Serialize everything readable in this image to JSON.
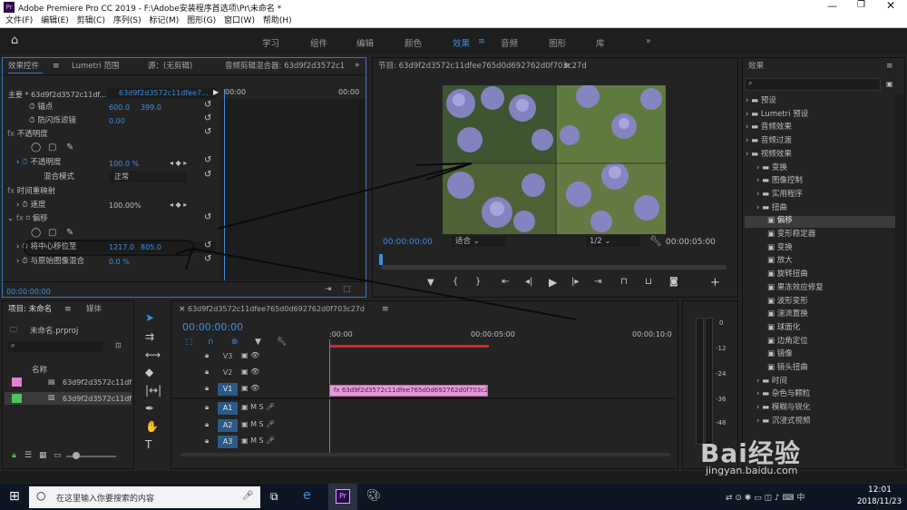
{
  "window": {
    "title": "Adobe Premiere Pro CC 2019 - F:\\Adobe安装程序首选项\\Pr\\未命名 *"
  },
  "menu": [
    "文件(F)",
    "编辑(E)",
    "剪辑(C)",
    "序列(S)",
    "标记(M)",
    "图形(G)",
    "窗口(W)",
    "帮助(H)"
  ],
  "workspaces": [
    "学习",
    "组件",
    "编辑",
    "颜色",
    "效果",
    "音频",
    "图形",
    "库"
  ],
  "effect_controls": {
    "tabs": [
      "效果控件",
      "Lumetri 范围",
      "源：(无剪辑)",
      "音频剪辑混合器: 63d9f2d3572c1"
    ],
    "master": "主要 * 63d9f2d3572c11df...",
    "clip": "63d9f2d3572c11dfee7...",
    "ruler_start": "00:00",
    "ruler_end": "00:00",
    "rows": [
      {
        "label": "锚点",
        "v1": "600.0",
        "v2": "399.0"
      },
      {
        "label": "防闪烁滤镜",
        "v1": "0.00"
      },
      {
        "label": "不透明度"
      },
      {
        "label": "不透明度",
        "v1": "100.0 %"
      },
      {
        "label": "混合模式",
        "v1": "正常"
      },
      {
        "label": "时间重映射"
      },
      {
        "label": "速度",
        "v1": "100.00%"
      },
      {
        "label": "偏移"
      },
      {
        "label": "将中心移位至",
        "v1": "1217.0",
        "v2": "805.0"
      },
      {
        "label": "与原始图像混合",
        "v1": "0.0 %"
      }
    ],
    "timecode": "00:00:00:00"
  },
  "program": {
    "title": "节目: 63d9f2d3572c11dfee765d0d692762d0f703c27d",
    "timecode": "00:00:00:00",
    "fit": "适合",
    "resolution": "1/2",
    "duration": "00:00:05:00"
  },
  "effects_panel": {
    "title": "效果",
    "items": [
      {
        "label": "预设",
        "level": 0
      },
      {
        "label": "Lumetri 预设",
        "level": 0
      },
      {
        "label": "音频效果",
        "level": 0
      },
      {
        "label": "音频过渡",
        "level": 0
      },
      {
        "label": "视频效果",
        "level": 0
      },
      {
        "label": "变换",
        "level": 1
      },
      {
        "label": "图像控制",
        "level": 1
      },
      {
        "label": "实用程序",
        "level": 1
      },
      {
        "label": "扭曲",
        "level": 1
      },
      {
        "label": "偏移",
        "level": 2,
        "sel": true
      },
      {
        "label": "变形稳定器",
        "level": 2
      },
      {
        "label": "变换",
        "level": 2
      },
      {
        "label": "放大",
        "level": 2
      },
      {
        "label": "旋转扭曲",
        "level": 2
      },
      {
        "label": "果冻效应修复",
        "level": 2
      },
      {
        "label": "波形变形",
        "level": 2
      },
      {
        "label": "湍流置换",
        "level": 2
      },
      {
        "label": "球面化",
        "level": 2
      },
      {
        "label": "边角定位",
        "level": 2
      },
      {
        "label": "镜像",
        "level": 2
      },
      {
        "label": "镜头扭曲",
        "level": 2
      },
      {
        "label": "时间",
        "level": 1
      },
      {
        "label": "杂色与颗粒",
        "level": 1
      },
      {
        "label": "模糊与锐化",
        "level": 1
      },
      {
        "label": "沉浸式视频",
        "level": 1
      }
    ]
  },
  "project": {
    "tabs": [
      "项目: 未命名",
      "媒体"
    ],
    "file": "未命名.prproj",
    "col": "名称",
    "items": [
      "63d9f2d3572c11df",
      "63d9f2d3572c11df"
    ]
  },
  "timeline": {
    "name": "63d9f2d3572c11dfee765d0d692762d0f703c27d",
    "timecode": "00:00:00:00",
    "ruler": [
      ":00:00",
      "00:00:05:00",
      "00:00:10:0"
    ],
    "tracks": [
      "V3",
      "V2",
      "V1",
      "A1",
      "A2",
      "A3"
    ],
    "clip": "63d9f2d3572c11dfee765d0d692762d0f703c27d.jp"
  },
  "meter": [
    "0",
    "-12",
    "-24",
    "-36",
    "-48"
  ],
  "taskbar": {
    "search": "在这里输入你要搜索的内容",
    "time": "12:01",
    "date": "2018/11/23"
  },
  "watermark": {
    "text": "Bai经验",
    "url": "jingyan.baidu.com"
  }
}
